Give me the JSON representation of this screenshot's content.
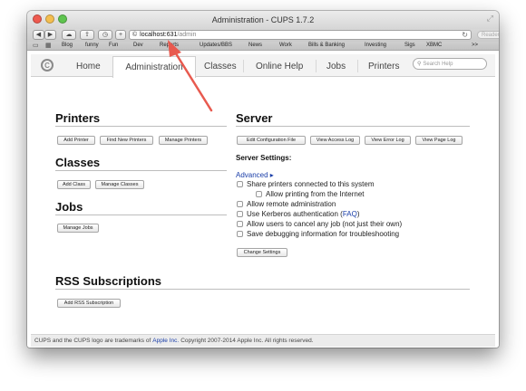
{
  "window": {
    "title": "Administration - CUPS 1.7.2"
  },
  "toolbar": {
    "back_icon": "back-arrow",
    "forward_icon": "forward-arrow",
    "icloud_icon": "cloud",
    "share_icon": "share",
    "history_icon": "clock",
    "new_tab_label": "+",
    "url_host": "localhost:631",
    "url_path": "/admin",
    "reader_label": "Reader"
  },
  "bookmarks": {
    "items": [
      "Blog",
      "funny",
      "Fun",
      "Dev",
      "Reports",
      "Updates/BBS",
      "News",
      "Work",
      "Bills & Banking",
      "Investing",
      "Sigs",
      "XBMC"
    ],
    "overflow_label": ">>"
  },
  "tabs": {
    "items": [
      "Home",
      "Administration",
      "Classes",
      "Online Help",
      "Jobs",
      "Printers"
    ],
    "active": "Administration",
    "search_placeholder": "Search Help"
  },
  "printers": {
    "title": "Printers",
    "buttons": [
      "Add Printer",
      "Find New Printers",
      "Manage Printers"
    ]
  },
  "classes": {
    "title": "Classes",
    "buttons": [
      "Add Class",
      "Manage Classes"
    ]
  },
  "jobs": {
    "title": "Jobs",
    "buttons": [
      "Manage Jobs"
    ]
  },
  "server": {
    "title": "Server",
    "buttons": [
      "Edit Configuration File",
      "View Access Log",
      "View Error Log",
      "View Page Log"
    ],
    "settings_label": "Server Settings:",
    "advanced_label": "Advanced ▸",
    "options": [
      "Share printers connected to this system",
      "Allow printing from the Internet",
      "Allow remote administration",
      "Use Kerberos authentication (",
      "Allow users to cancel any job (not just their own)",
      "Save debugging information for troubleshooting"
    ],
    "faq_label": "FAQ",
    "faq_close": ")",
    "change_button": "Change Settings"
  },
  "rss": {
    "title": "RSS Subscriptions",
    "button": "Add RSS Subscription"
  },
  "footer": {
    "text_before": "CUPS and the CUPS logo are trademarks of ",
    "link": "Apple Inc.",
    "text_after": " Copyright 2007-2014 Apple Inc. All rights reserved."
  },
  "colors": {
    "link": "#1a3ea8",
    "annotation_arrow": "#e85a4f"
  }
}
